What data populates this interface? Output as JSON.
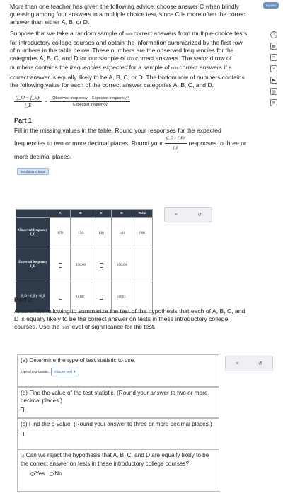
{
  "header": {
    "language_label": "Español"
  },
  "intro": {
    "p1": "More than one teacher has given the following advice: choose answer C when blindly guessing among four answers in a multiple choice test, since C is more often the correct answer than either A, B, or D.",
    "p2a": "Suppose that we take a random sample of",
    "sample_size": "600",
    "p2b": "correct answers from multiple-choice tests for introductory college courses and obtain the information summarized by the first row of numbers in the table below. These numbers are the observed frequencies for the categories A, B, C, and D for our sample of",
    "p2c": "correct answers. The second row of numbers contains the",
    "p2_em": "frequencies expected",
    "p2d": "for a sample of",
    "p2e": "correct answers if a correct answer is equally likely to be A, B, C, or D. The bottom row of numbers contains the following value for each of the correct answer categories A, B, C, and D."
  },
  "formula": {
    "lhs_num": "(f_O − f_E)²",
    "lhs_den": "f_E",
    "rhs_num": "(Observed frequency − Expected frequency)²",
    "rhs_den": "Expected frequency"
  },
  "part1": {
    "title": "Part 1",
    "text_a": "Fill in the missing values in the table. Round your responses for the expected frequencies to two or more decimal places. Round your",
    "text_b": "responses to three or more decimal places.",
    "excel_button": "Send data to Excel"
  },
  "table": {
    "headers": [
      "A",
      "B",
      "C",
      "D",
      "Total"
    ],
    "rows": [
      {
        "label": "Observed frequency f_O",
        "cells": [
          "170",
          "154",
          "136",
          "140",
          "600"
        ]
      },
      {
        "label": "Expected frequency f_E",
        "cells": [
          "",
          "150.00",
          "",
          "150.00",
          ""
        ]
      },
      {
        "label": "(f_O − f_E)² / f_E",
        "cells": [
          "",
          "0.107",
          "",
          "0.667",
          ""
        ]
      }
    ]
  },
  "side_panel": {
    "close": "×",
    "reset": "↺"
  },
  "part2": {
    "title": "Part 2",
    "text_a": "Answer the following to summarize the test of the hypothesis that each of A, B, C, and D is equally likely to be the correct answer on tests in these introductory college courses. Use the",
    "significance": "0.05",
    "text_b": "level of significance for the test.",
    "qa": "(a) Determine the type of test statistic to use.",
    "qa_label": "Type of test statistic:",
    "qa_select": "(Choose one)",
    "qb": "(b) Find the value of the test statistic. (Round your answer to two or more decimal places.)",
    "qc": "(c) Find the p-value. (Round your answer to three or more decimal places.)",
    "qd_prefix": "(d)",
    "qd": "Can we reject the hypothesis that A, B, C, and D are equally likely to be the correct answer on tests in these introductory college courses?",
    "yes": "Yes",
    "no": "No"
  }
}
